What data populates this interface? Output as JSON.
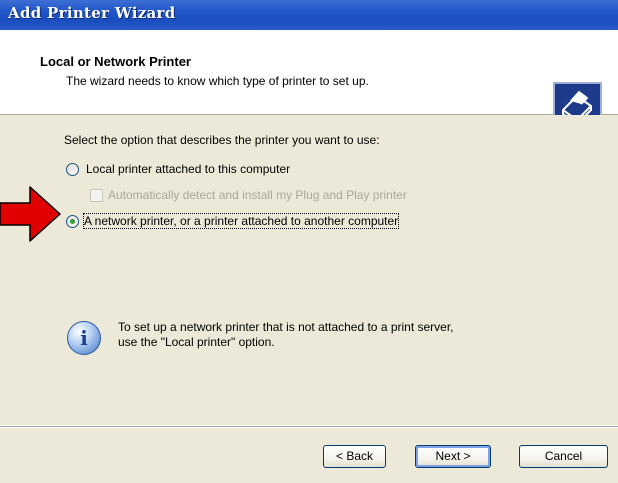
{
  "window": {
    "title": "Add Printer Wizard"
  },
  "header": {
    "title": "Local or Network Printer",
    "subtitle": "The wizard needs to know which type of printer to set up.",
    "icon": "printer-icon"
  },
  "body": {
    "prompt": "Select the option that describes the printer you want to use:",
    "options": [
      {
        "label": "Local printer attached to this computer",
        "selected": false
      },
      {
        "label": "A network printer, or a printer attached to another computer",
        "selected": true
      }
    ],
    "auto_detect": {
      "label": "Automatically detect and install my Plug and Play printer",
      "checked": false,
      "enabled": false
    },
    "info_icon": "info-icon",
    "info_line1": "To set up a network printer that is not attached to a print server,",
    "info_line2": "use the \"Local printer\" option."
  },
  "buttons": {
    "back": "< Back",
    "next": "Next >",
    "cancel": "Cancel"
  },
  "colors": {
    "title_bar": "#2257c9",
    "dialog_bg": "#ece9d8",
    "annotation_arrow": "#e00000",
    "radio_dot": "#2fa12f"
  }
}
